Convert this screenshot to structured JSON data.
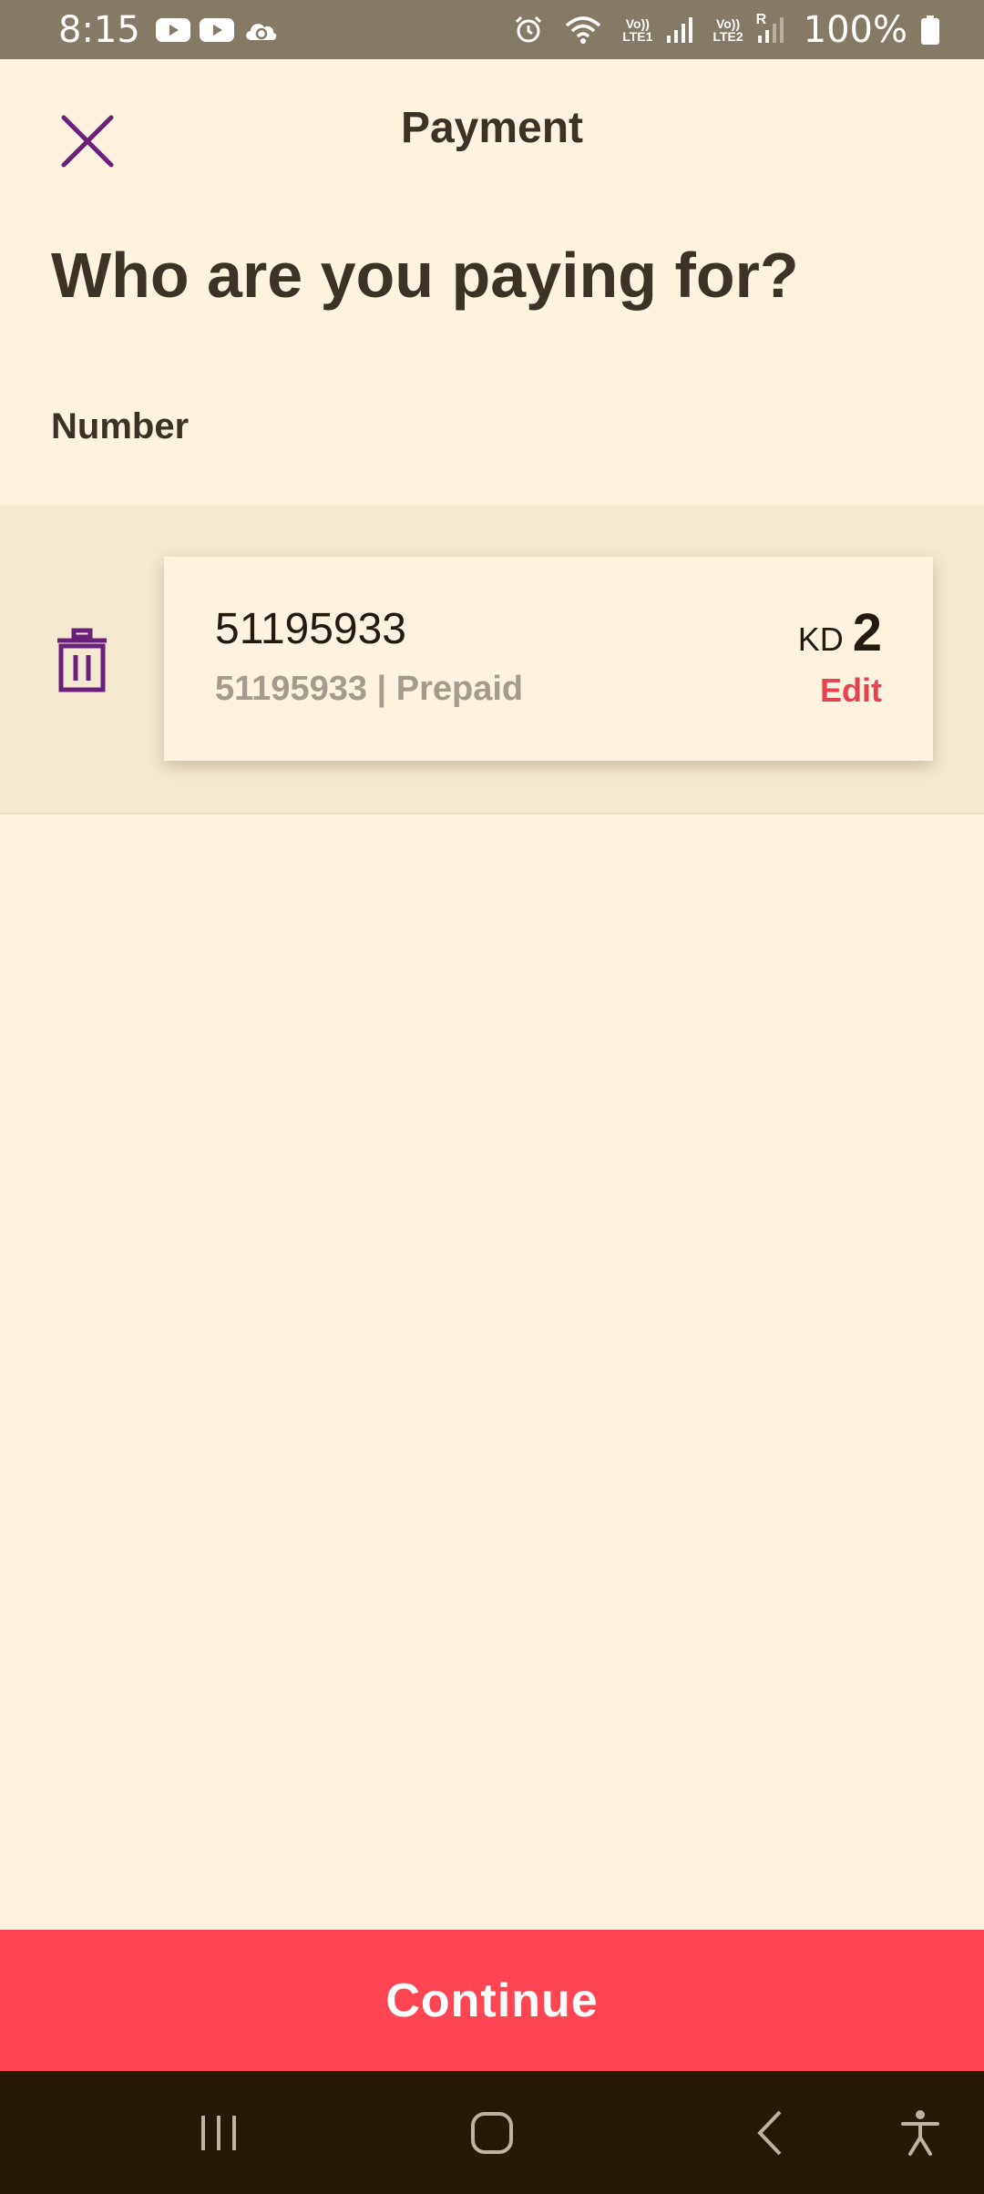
{
  "status_bar": {
    "time": "8:15",
    "icons": [
      "youtube-icon",
      "youtube-icon",
      "cloud-sync-icon",
      "alarm-icon",
      "wifi-icon",
      "signal-icon",
      "signal-icon"
    ],
    "sim1_label_top": "Vo))",
    "sim1_label_bottom": "LTE1",
    "sim2_label_top": "Vo))",
    "sim2_label_bottom": "LTE2",
    "roaming": "R",
    "battery": "100%"
  },
  "header": {
    "title": "Payment",
    "close_icon": "close-icon"
  },
  "main": {
    "heading": "Who are you paying for?",
    "section_label": "Number",
    "items": [
      {
        "number": "51195933",
        "subtitle": "51195933 | Prepaid",
        "currency": "KD",
        "amount": "2",
        "edit_label": "Edit",
        "delete_icon": "trash-icon"
      }
    ]
  },
  "footer": {
    "continue_label": "Continue"
  },
  "nav_bar": {
    "icons": [
      "recent-apps-icon",
      "home-icon",
      "back-icon",
      "accessibility-icon"
    ]
  },
  "colors": {
    "background": "#FDF3DE",
    "status_bar": "#857A65",
    "accent_purple": "#6A1F7A",
    "primary_red": "#FF4552",
    "edit_red": "#E8424F",
    "nav_bar": "#261907"
  }
}
